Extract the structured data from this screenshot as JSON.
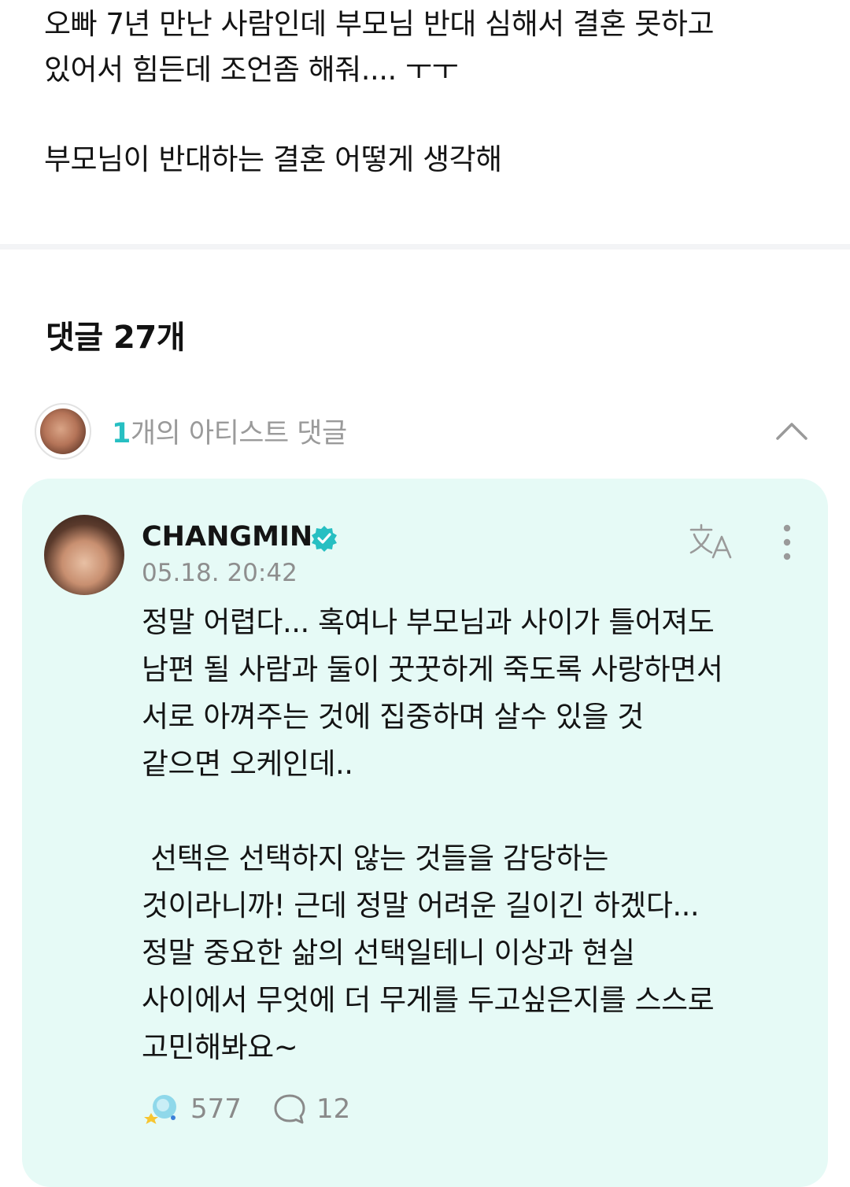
{
  "post": {
    "lines": [
      "오빠 7년 만난 사람인데 부모님 반대 심해서 결혼 못하고",
      "있어서 힘든데 조언좀 해줘.... ㅜㅜ",
      "",
      "부모님이 반대하는 결혼 어떻게 생각해"
    ]
  },
  "comments_header": {
    "label": "댓글 27개"
  },
  "artist_comments": {
    "count": "1",
    "label": "개의 아티스트 댓글",
    "icon": "chevron-up-icon"
  },
  "comment": {
    "author": "CHANGMIN",
    "verified": true,
    "timestamp": "05.18. 20:42",
    "lines": [
      "정말 어렵다... 혹여나 부모님과 사이가 틀어져도",
      "남편 될 사람과 둘이 꿋꿋하게 죽도록 사랑하면서",
      "서로 아껴주는 것에 집중하며 살수 있을 것",
      "같으면 오케인데..",
      "",
      " 선택은 선택하지 않는 것들을 감당하는",
      "것이라니까! 근데 정말 어려운 길이긴 하겠다...",
      "정말 중요한 삶의 선택일테니 이상과 현실",
      "사이에서 무엇에 더 무게를 두고싶은지를 스스로",
      "고민해봐요~"
    ],
    "cheer_count": "577",
    "reply_count": "12",
    "icons": {
      "translate": "translate-icon",
      "more": "more-vertical-icon",
      "cheer": "cheer-icon",
      "reply": "reply-bubble-icon",
      "verified": "verified-badge-icon"
    }
  },
  "colors": {
    "accent": "#27bfc2",
    "card_background": "#e6faf6",
    "muted_text": "#8e8e8e"
  }
}
